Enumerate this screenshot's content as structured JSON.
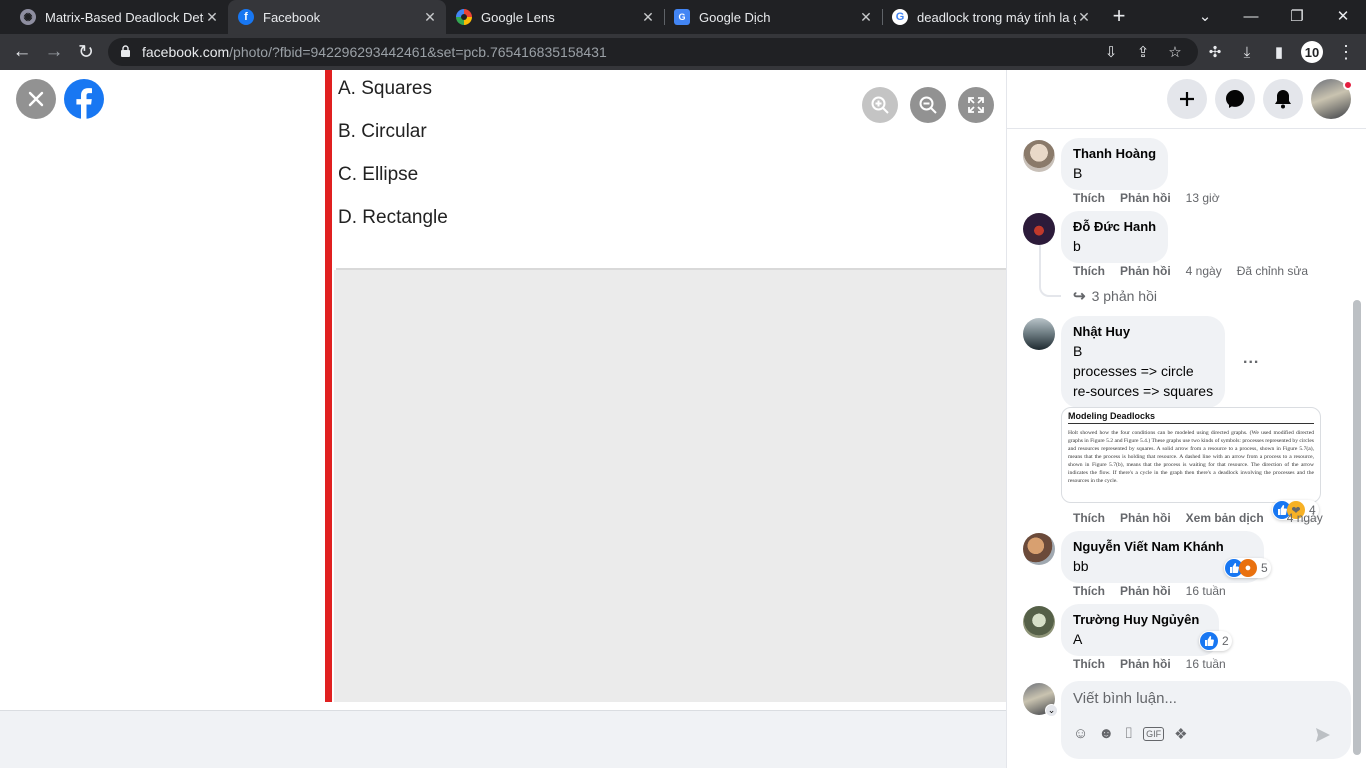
{
  "browser": {
    "tabs": [
      {
        "title": "Matrix-Based Deadlock Dete",
        "icon": "chatgpt-icon"
      },
      {
        "title": "Facebook",
        "icon": "facebook-icon"
      },
      {
        "title": "Google Lens",
        "icon": "google-lens-icon"
      },
      {
        "title": "Google Dịch",
        "icon": "google-translate-icon"
      },
      {
        "title": "deadlock trong máy tính la g",
        "icon": "google-icon"
      }
    ],
    "new_tab": "+",
    "url_host": "facebook.com",
    "url_path": "/photo/?fbid=942296293442461&set=pcb.765416835158431",
    "profile_badge": "10"
  },
  "photo": {
    "options": [
      "A.  Squares",
      "B.  Circular",
      "C.  Ellipse",
      "D.  Rectangle"
    ]
  },
  "comments": [
    {
      "name": "Thanh Hoàng",
      "lines": [
        "B"
      ],
      "actions": {
        "like": "Thích",
        "reply": "Phản hồi",
        "time": "13 giờ"
      }
    },
    {
      "name": "Đỗ Đức Hanh",
      "lines": [
        "b"
      ],
      "actions": {
        "like": "Thích",
        "reply": "Phản hồi",
        "time": "4 ngày",
        "edited": "Đã chỉnh sửa"
      },
      "replies": "3 phản hồi"
    },
    {
      "name": "Nhật Huy",
      "lines": [
        "B",
        "processes => circle",
        "re-sources => squares"
      ],
      "more": "...",
      "attachment": {
        "title": "Modeling Deadlocks",
        "body": "Holt showed how the four conditions can be modeled using directed graphs. (We used modified directed graphs in Figure 5.2 and Figure 5.4.) These graphs use two kinds of symbols: processes represented by circles and resources represented by squares. A solid arrow from a resource to a process, shown in Figure 5.7(a), means that the process is holding that resource. A dashed line with an arrow from a process to a resource, shown in Figure 5.7(b), means that the process is waiting for that resource. The direction of the arrow indicates the flow. If there's a cycle in the graph then there's a deadlock involving the processes and the resources in the cycle."
      },
      "reactions": "4",
      "actions": {
        "like": "Thích",
        "reply": "Phản hồi",
        "translate": "Xem bản dịch",
        "time": "4 ngày"
      }
    },
    {
      "name": "Nguyễn Viết Nam Khánh",
      "lines": [
        "bb"
      ],
      "reactions": "5",
      "actions": {
        "like": "Thích",
        "reply": "Phản hồi",
        "time": "16 tuần"
      }
    },
    {
      "name": "Trường Huy Ngủyên",
      "lines": [
        "A"
      ],
      "reactions": "2",
      "actions": {
        "like": "Thích",
        "reply": "Phản hồi",
        "time": "16 tuần"
      }
    }
  ],
  "composer": {
    "placeholder": "Viết bình luận..."
  },
  "colors": {
    "facebook_blue": "#1877f2",
    "highlight_red": "#e02020"
  }
}
